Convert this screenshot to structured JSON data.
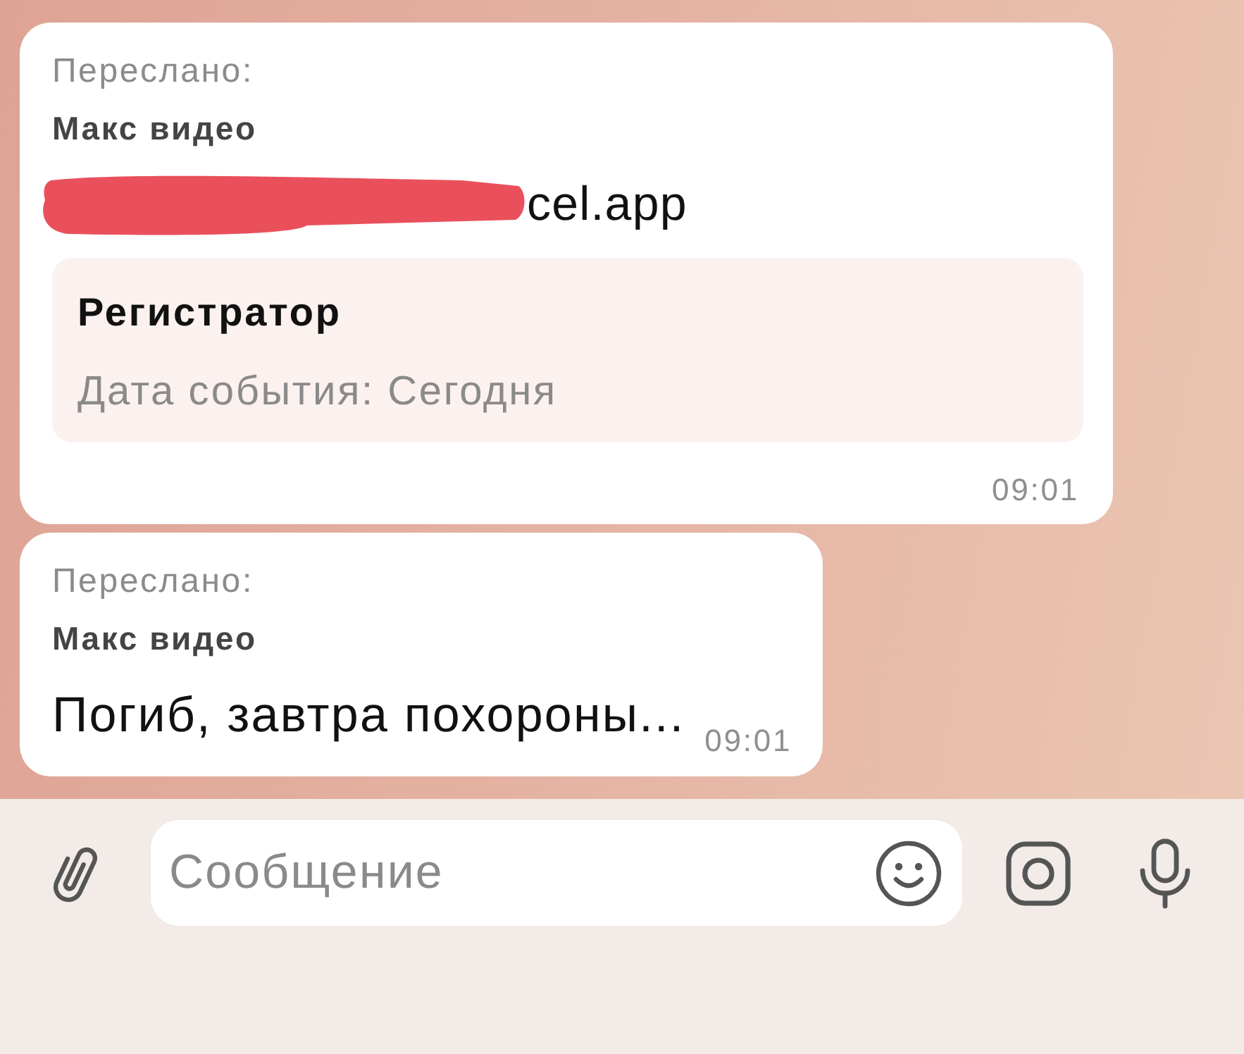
{
  "messages": [
    {
      "kind": "link",
      "forwarded_label": "Переслано:",
      "forwarded_from": "Макс видео",
      "link": {
        "text": "cel.app",
        "redacted": true
      },
      "preview": {
        "title": "Регистратор",
        "subtitle": "Дата события: Сегодня"
      },
      "time": "09:01"
    },
    {
      "kind": "text",
      "forwarded_label": "Переслано:",
      "forwarded_from": "Макс видео",
      "text": "Погиб, завтра похороны...",
      "time": "09:01"
    }
  ],
  "composer": {
    "placeholder": "Сообщение"
  }
}
